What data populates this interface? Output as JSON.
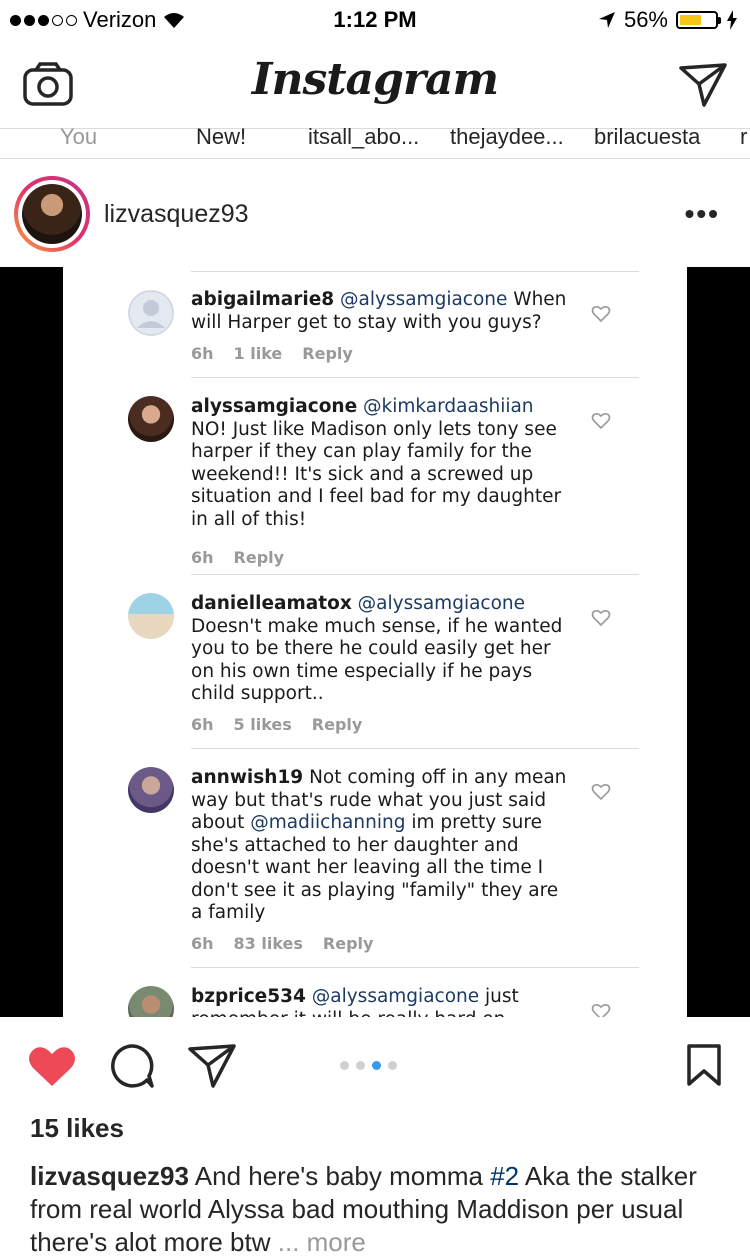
{
  "status_bar": {
    "carrier": "Verizon",
    "time": "1:12 PM",
    "battery": "56%"
  },
  "nav": {
    "logo": "Instagram",
    "left_icon": "camera-icon",
    "right_icon": "direct-send-icon"
  },
  "stories": [
    "You",
    "New!",
    "itsall_abo...",
    "thejaydee...",
    "brilacuesta",
    "r"
  ],
  "post": {
    "username": "lizvasquez93",
    "more_icon": "•••",
    "likes": "15 likes",
    "caption_user": "lizvasquez93",
    "caption_text_1": " And here's baby momma ",
    "caption_tag": "#2",
    "caption_text_2": " Aka the stalker from real world Alyssa bad mouthing Maddison per usual there's alot more btw",
    "caption_more": "... more",
    "carousel": {
      "count": 4,
      "active_index": 2
    }
  },
  "comments": [
    {
      "user": "abigailmarie8",
      "mention": "@alyssamgiacone",
      "text": " When will Harper get to stay with you guys?",
      "time": "6h",
      "likes": "1 like",
      "reply": "Reply"
    },
    {
      "user": "alyssamgiacone",
      "mention": "@kimkardaashiian",
      "text": " NO! Just like Madison only lets tony see harper if they can play family for the weekend!! It's sick and a screwed up situation and I feel bad for my daughter in all of this!",
      "time": "6h",
      "likes": "",
      "reply": "Reply"
    },
    {
      "user": "danielleamatox",
      "mention": "@alyssamgiacone",
      "text": " Doesn't make much sense, if he wanted you to be there he could easily get her on his own time especially if he pays child support..",
      "time": "6h",
      "likes": "5 likes",
      "reply": "Reply"
    },
    {
      "user": "annwish19",
      "text_a": " Not coming off in any mean way but that's rude what you just said about ",
      "mention": "@madiichanning",
      "text_b": " im pretty sure she's attached to her daughter and doesn't want her leaving all the time I don't see it as playing \"family\" they are a family",
      "time": "6h",
      "likes": "83 likes",
      "reply": "Reply"
    },
    {
      "user": "bzprice534",
      "mention": "@alyssamgiacone",
      "text": " just remember it will be really hard on",
      "time": "",
      "likes": "",
      "reply": ""
    }
  ]
}
